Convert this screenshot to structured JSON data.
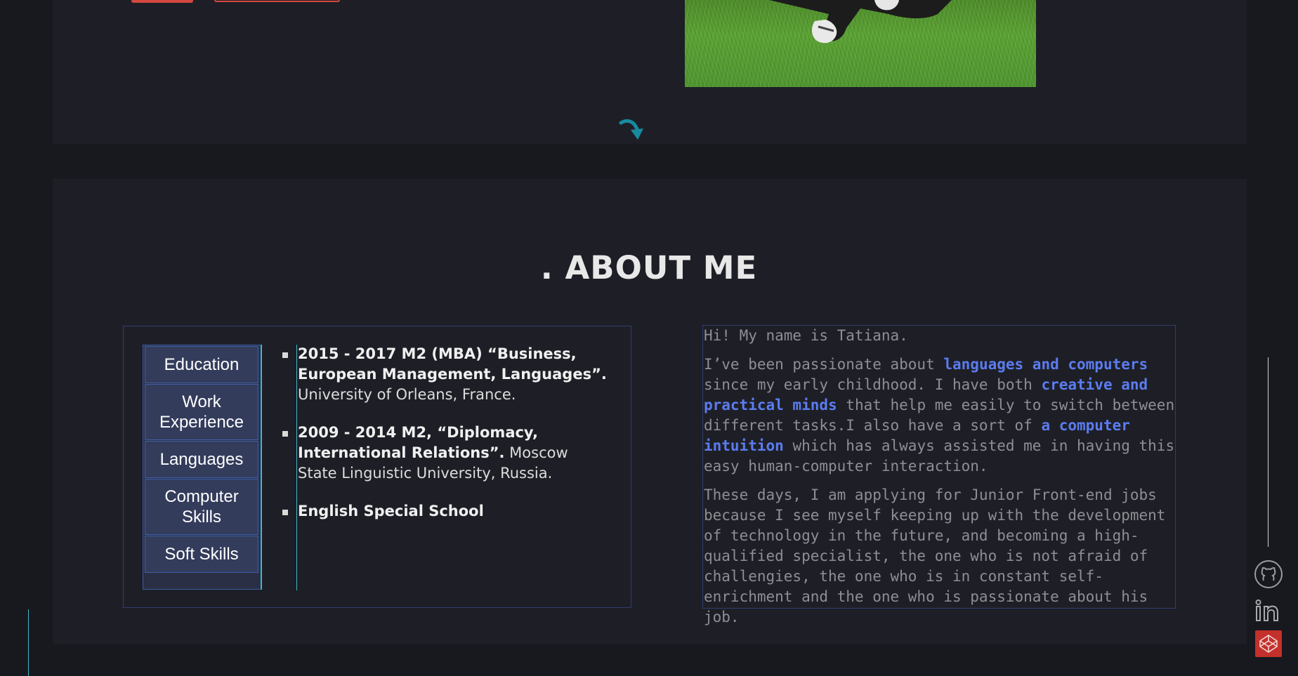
{
  "hero": {
    "photo_alt": "Photo of person sitting on grass"
  },
  "about": {
    "title": ". ABOUT ME",
    "tabs": [
      {
        "label": "Education"
      },
      {
        "label": "Work Experience"
      },
      {
        "label": "Languages"
      },
      {
        "label": "Computer Skills"
      },
      {
        "label": "Soft Skills"
      }
    ],
    "education": [
      {
        "bold": "2015 - 2017 M2 (MBA) “Business, European Management, Languages”.",
        "text": " University of Orleans, France."
      },
      {
        "bold": "2009 - 2014 M2, “Diplomacy, International Relations”.",
        "text": " Moscow State Linguistic University, Russia."
      },
      {
        "bold": "English Special School",
        "text": ""
      }
    ],
    "intro": {
      "p1": "Hi! My name is Tatiana.",
      "p2_a": "I’ve been passionate about ",
      "p2_hl1": "languages and computers",
      "p2_b": " since my early childhood. I have both ",
      "p2_hl2": "creative and practical minds",
      "p2_c": " that help me easily to switch between different tasks.I also have a sort of ",
      "p2_hl3": "a computer intuition",
      "p2_d": " which has always assisted me in having this easy human-computer interaction.",
      "p3": "These days, I am applying for Junior Front-end jobs because I see myself keeping up with the development of technology in the future, and becoming a high-qualified specialist, the one who is not afraid of challengies, the one who is in constant self-enrichment and the one who is passionate about his job."
    }
  },
  "social": {
    "github_icon": "github-icon",
    "linkedin_icon": "linkedin-icon",
    "codepen_icon": "codepen-icon"
  },
  "colors": {
    "accent": "#d5483f",
    "teal": "#3fb7c8",
    "highlight": "#5b7cf0"
  }
}
